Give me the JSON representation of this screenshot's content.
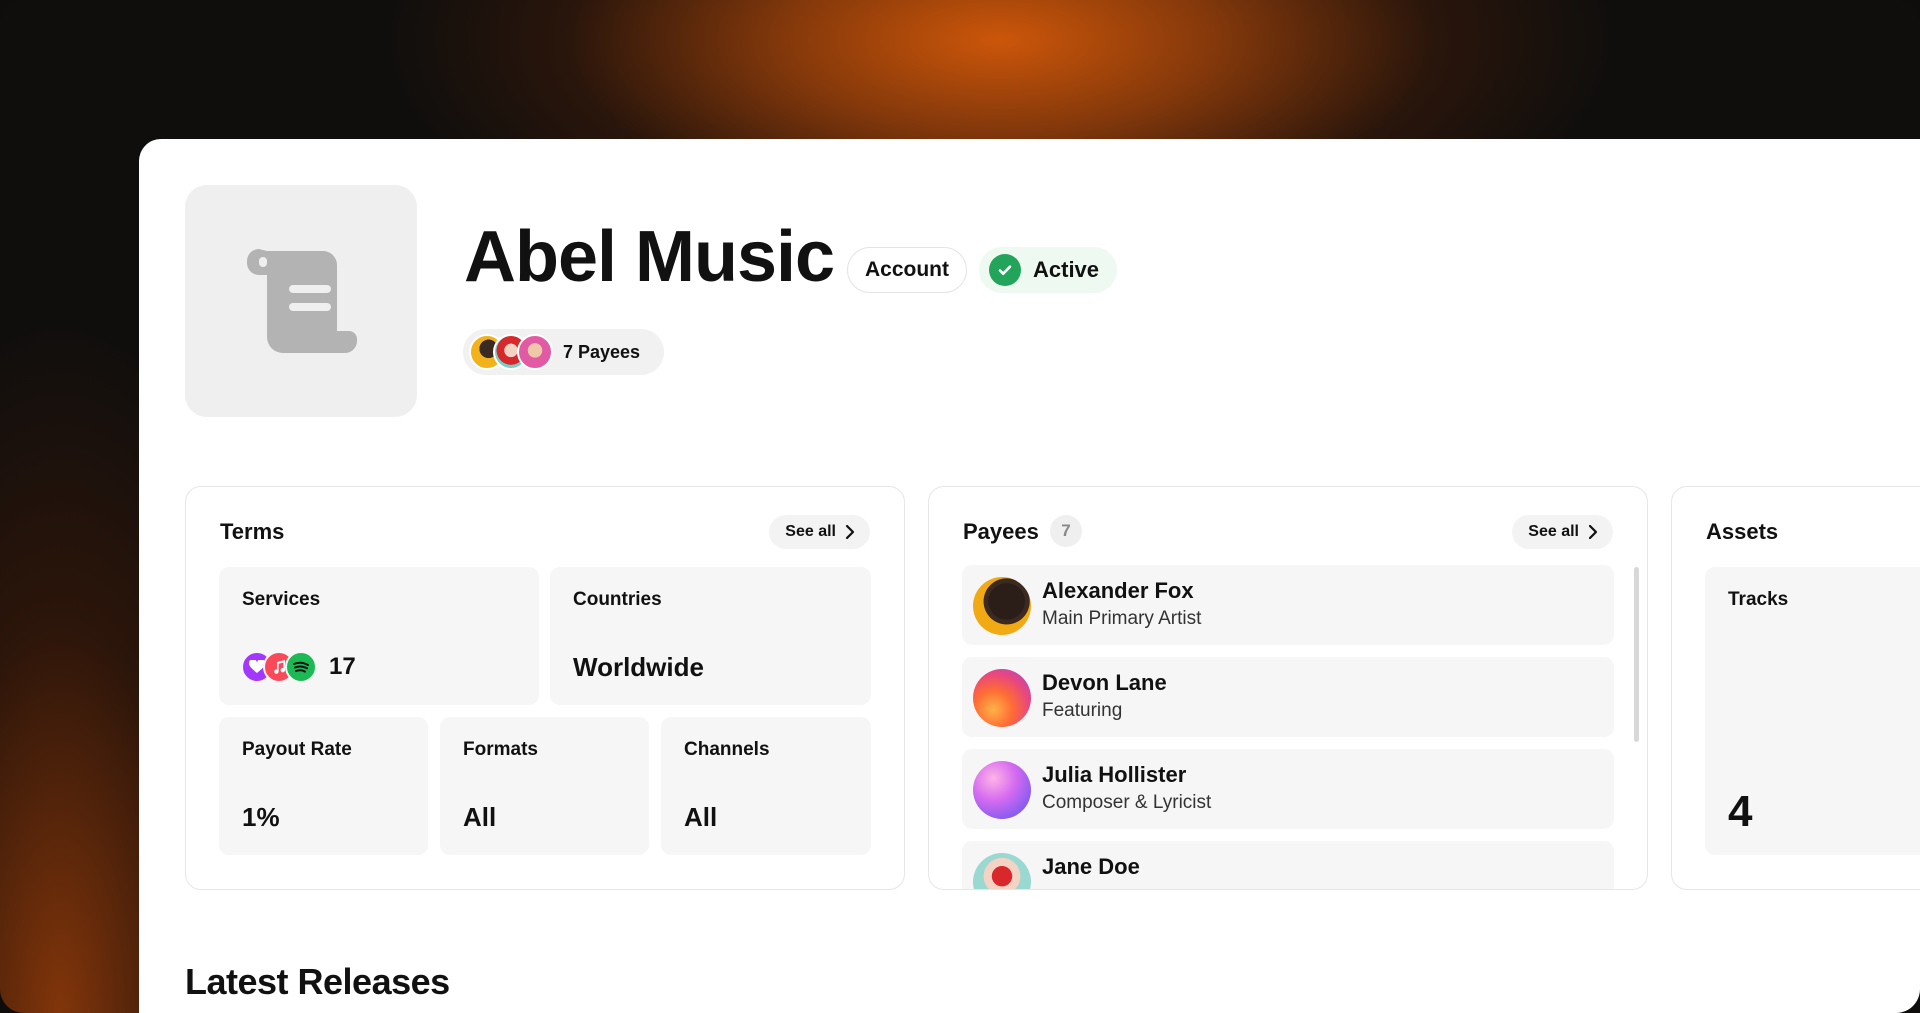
{
  "header": {
    "title": "Abel Music",
    "type_badge": "Account",
    "status_badge": "Active",
    "payees_chip": "7 Payees",
    "status_color": "#22a55a"
  },
  "terms": {
    "title": "Terms",
    "see_all": "See all",
    "services": {
      "label": "Services",
      "count": "17",
      "icons": [
        "deezer-icon",
        "apple-music-icon",
        "spotify-icon"
      ]
    },
    "countries": {
      "label": "Countries",
      "value": "Worldwide"
    },
    "payout_rate": {
      "label": "Payout Rate",
      "value": "1%"
    },
    "formats": {
      "label": "Formats",
      "value": "All"
    },
    "channels": {
      "label": "Channels",
      "value": "All"
    }
  },
  "payees": {
    "title": "Payees",
    "count": "7",
    "see_all": "See all",
    "items": [
      {
        "name": "Alexander Fox",
        "role": "Main Primary Artist"
      },
      {
        "name": "Devon Lane",
        "role": "Featuring"
      },
      {
        "name": "Julia Hollister",
        "role": "Composer & Lyricist"
      },
      {
        "name": "Jane Doe",
        "role": ""
      }
    ]
  },
  "assets": {
    "title": "Assets",
    "tracks": {
      "label": "Tracks",
      "value": "4"
    }
  },
  "releases": {
    "title": "Latest Releases"
  }
}
